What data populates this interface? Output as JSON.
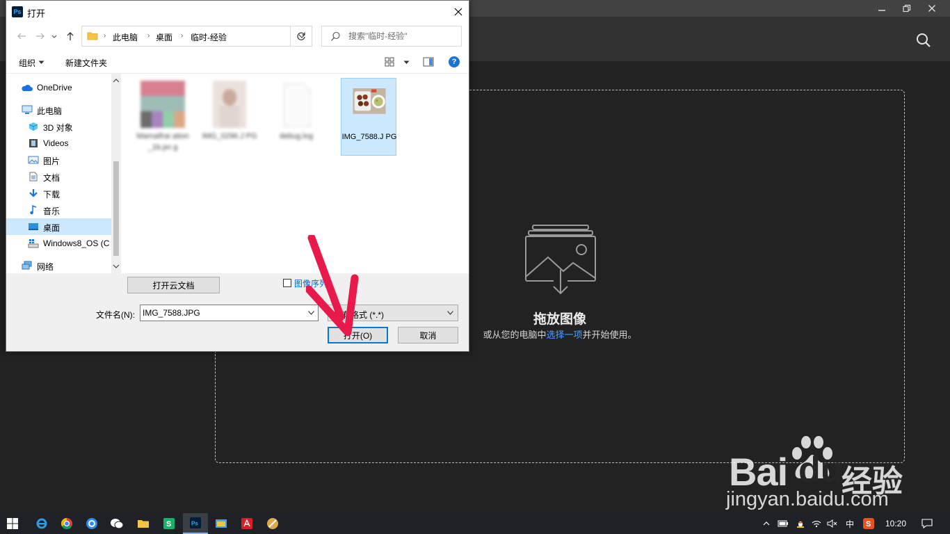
{
  "photoshop": {
    "drop_title": "拖放图像",
    "drop_sub_before": "或从您的电脑中",
    "drop_sub_link": "选择一项",
    "drop_sub_after": "并开始使用。"
  },
  "dialog": {
    "title": "打开",
    "app_icon_text": "Ps",
    "breadcrumbs": [
      "此电脑",
      "桌面",
      "临时-经验"
    ],
    "search_placeholder": "搜索\"临时-经验\"",
    "toolbar": {
      "organize": "组织",
      "new_folder": "新建文件夹",
      "help": "?"
    },
    "nav_items": [
      {
        "label": "OneDrive",
        "icon": "cloud-icon"
      },
      {
        "label": "此电脑",
        "icon": "computer-icon"
      },
      {
        "label": "3D 对象",
        "icon": "cube-icon"
      },
      {
        "label": "Videos",
        "icon": "film-icon"
      },
      {
        "label": "图片",
        "icon": "picture-icon"
      },
      {
        "label": "文档",
        "icon": "document-icon"
      },
      {
        "label": "下载",
        "icon": "download-icon"
      },
      {
        "label": "音乐",
        "icon": "music-icon"
      },
      {
        "label": "桌面",
        "icon": "desktop-icon",
        "selected": true
      },
      {
        "label": "Windows8_OS (C",
        "icon": "drive-icon"
      },
      {
        "label": "网络",
        "icon": "network-icon"
      }
    ],
    "files": [
      {
        "name": "Mamaifrai ation_1b.pn g",
        "blurred": true
      },
      {
        "name": "IMG_0296.J PG",
        "blurred": true
      },
      {
        "name": "debug.log",
        "blurred": true
      },
      {
        "name": "IMG_7588.J PG",
        "blurred": false,
        "selected": true
      }
    ],
    "cloud_button": "打开云文档",
    "sequence_label": "图像序列",
    "filename_label": "文件名(N):",
    "filename_value": "IMG_7588.JPG",
    "filetype_value": "所有格式 (*.*)",
    "open_button": "打开(O)",
    "cancel_button": "取消"
  },
  "watermark": {
    "brand_left": "Bai",
    "brand_mid": "du",
    "brand_right": "经验",
    "url": "jingyan.baidu.com"
  },
  "taskbar": {
    "ime": "中",
    "clock": "10:20",
    "apps": [
      "windows-start",
      "internet-explorer",
      "chrome",
      "qq-browser",
      "wechat",
      "file-explorer",
      "green-app",
      "photoshop",
      "folder-app",
      "adobe-reader",
      "utility-app"
    ]
  },
  "colors": {
    "ps_background": "#222222",
    "link_blue": "#4aa3ff",
    "selection": "#cce8ff",
    "annotation_red": "#e8194b",
    "taskbar": "#1e2227"
  }
}
